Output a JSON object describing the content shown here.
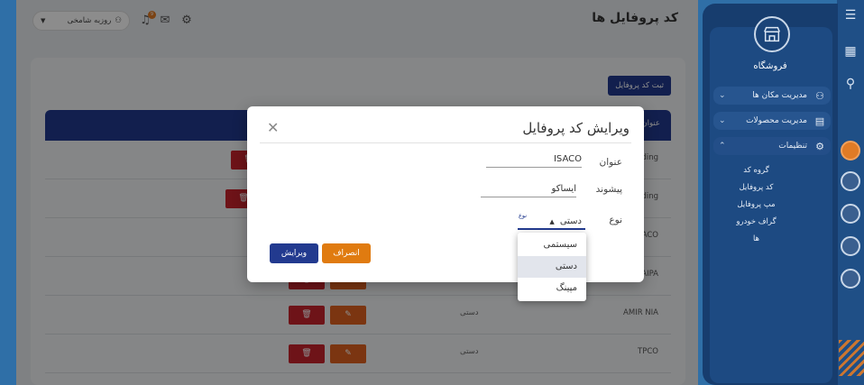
{
  "sidebar": {
    "store_title": "فروشگاه",
    "items": [
      {
        "label": "مدیریت مکان ها",
        "icon": "users-icon"
      },
      {
        "label": "مدیریت محصولات",
        "icon": "store-icon"
      },
      {
        "label": "تنظیمات",
        "icon": "gear-icon"
      }
    ],
    "submenu": [
      "گروه کد",
      "کد پروفایل",
      "مپ پروفایل",
      "گراف خودرو ها"
    ]
  },
  "header": {
    "page_title": "کد پروفایل ها",
    "user_name": "روزبه شامخی",
    "notification_count": "9"
  },
  "main": {
    "add_button": "ثبت کد پروفایل",
    "table": {
      "column_title": "عنوان",
      "rows": [
        {
          "title": "coding",
          "type": ""
        },
        {
          "title": "coding",
          "type": ""
        },
        {
          "title": "ISACO",
          "type": ""
        },
        {
          "title": "SAIPA",
          "type": ""
        },
        {
          "title": "AMIR NIA",
          "type": "دستی"
        },
        {
          "title": "TPCO",
          "type": "دستی"
        }
      ]
    }
  },
  "modal": {
    "title": "ویرایش کد پروفایل",
    "fields": {
      "title_label": "عنوان",
      "title_value": "ISACO",
      "prefix_label": "پیشوند",
      "prefix_value": "ایساکو",
      "type_label": "نوع",
      "type_small_label": "نوع",
      "type_value": "دستی"
    },
    "edit_button": "ویرایش",
    "cancel_button": "انصراف",
    "dropdown_options": [
      "سیستمی",
      "دستی",
      "مپینگ"
    ]
  },
  "colors": {
    "primary": "#223a8f",
    "cancel": "#e07b10",
    "delete": "#c8232c",
    "edit": "#e0621f",
    "sidebar": "#173d6e"
  }
}
